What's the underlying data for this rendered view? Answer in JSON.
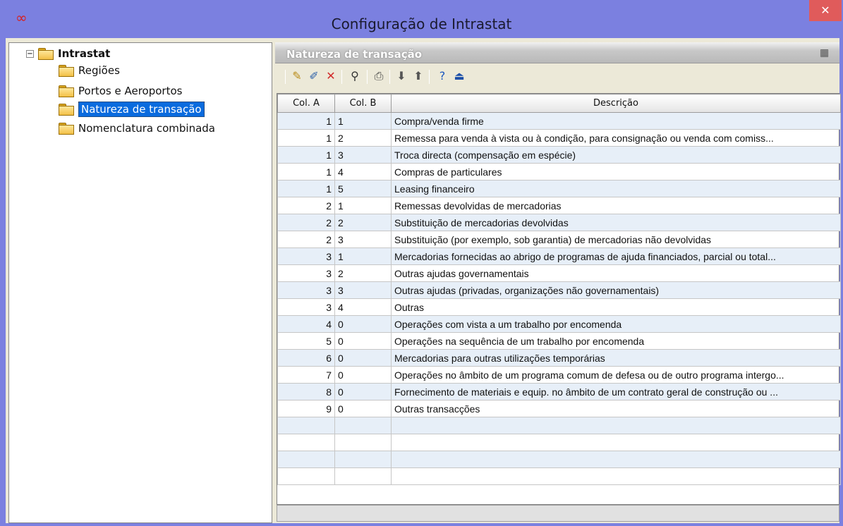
{
  "window": {
    "title": "Configuração de Intrastat",
    "close_label": "✕",
    "app_icon": "infinity-icon",
    "accent": "#7b80e0",
    "close_color": "#e05b5b"
  },
  "tree": {
    "root": {
      "label": "Intrastat",
      "expander": "⊟"
    },
    "items": [
      {
        "label": "Regiões"
      },
      {
        "label": "Portos e Aeroportos"
      },
      {
        "label": "Natureza de transação"
      },
      {
        "label": "Nomenclatura combinada"
      }
    ],
    "selected_index": 2
  },
  "panel": {
    "title": "Natureza de transação"
  },
  "toolbar": {
    "buttons": [
      "new-icon",
      "edit-icon",
      "delete-icon",
      "find-icon",
      "print-icon",
      "import-icon",
      "export-icon",
      "help-icon",
      "exit-icon"
    ]
  },
  "grid": {
    "headers": [
      "Col. A",
      "Col. B",
      "Descrição"
    ],
    "rows": [
      [
        "1",
        "1",
        "Compra/venda firme"
      ],
      [
        "1",
        "2",
        "Remessa para venda à vista ou à condição, para consignação ou venda  com comiss..."
      ],
      [
        "1",
        "3",
        "Troca directa (compensação em espécie)"
      ],
      [
        "1",
        "4",
        "Compras de particulares"
      ],
      [
        "1",
        "5",
        "Leasing financeiro"
      ],
      [
        "2",
        "1",
        "Remessas devolvidas de mercadorias"
      ],
      [
        "2",
        "2",
        "Substituição de mercadorias devolvidas"
      ],
      [
        "2",
        "3",
        "Substituição (por exemplo, sob garantia) de mercadorias não devolvidas"
      ],
      [
        "3",
        "1",
        "Mercadorias fornecidas ao abrigo de programas de ajuda financiados, parcial ou total..."
      ],
      [
        "3",
        "2",
        "Outras ajudas governamentais"
      ],
      [
        "3",
        "3",
        "Outras ajudas (privadas, organizações não governamentais)"
      ],
      [
        "3",
        "4",
        "Outras"
      ],
      [
        "4",
        "0",
        "Operações com vista a um trabalho por encomenda"
      ],
      [
        "5",
        "0",
        "Operações na sequência de um trabalho por encomenda"
      ],
      [
        "6",
        "0",
        "Mercadorias para outras utilizações temporárias"
      ],
      [
        "7",
        "0",
        "Operações no âmbito de um programa comum de defesa ou de outro programa intergo..."
      ],
      [
        "8",
        "0",
        "Fornecimento de materiais e equip. no âmbito de um contrato geral de construção ou ..."
      ],
      [
        "9",
        "0",
        "Outras transacções"
      ]
    ],
    "empty_rows": 4
  }
}
